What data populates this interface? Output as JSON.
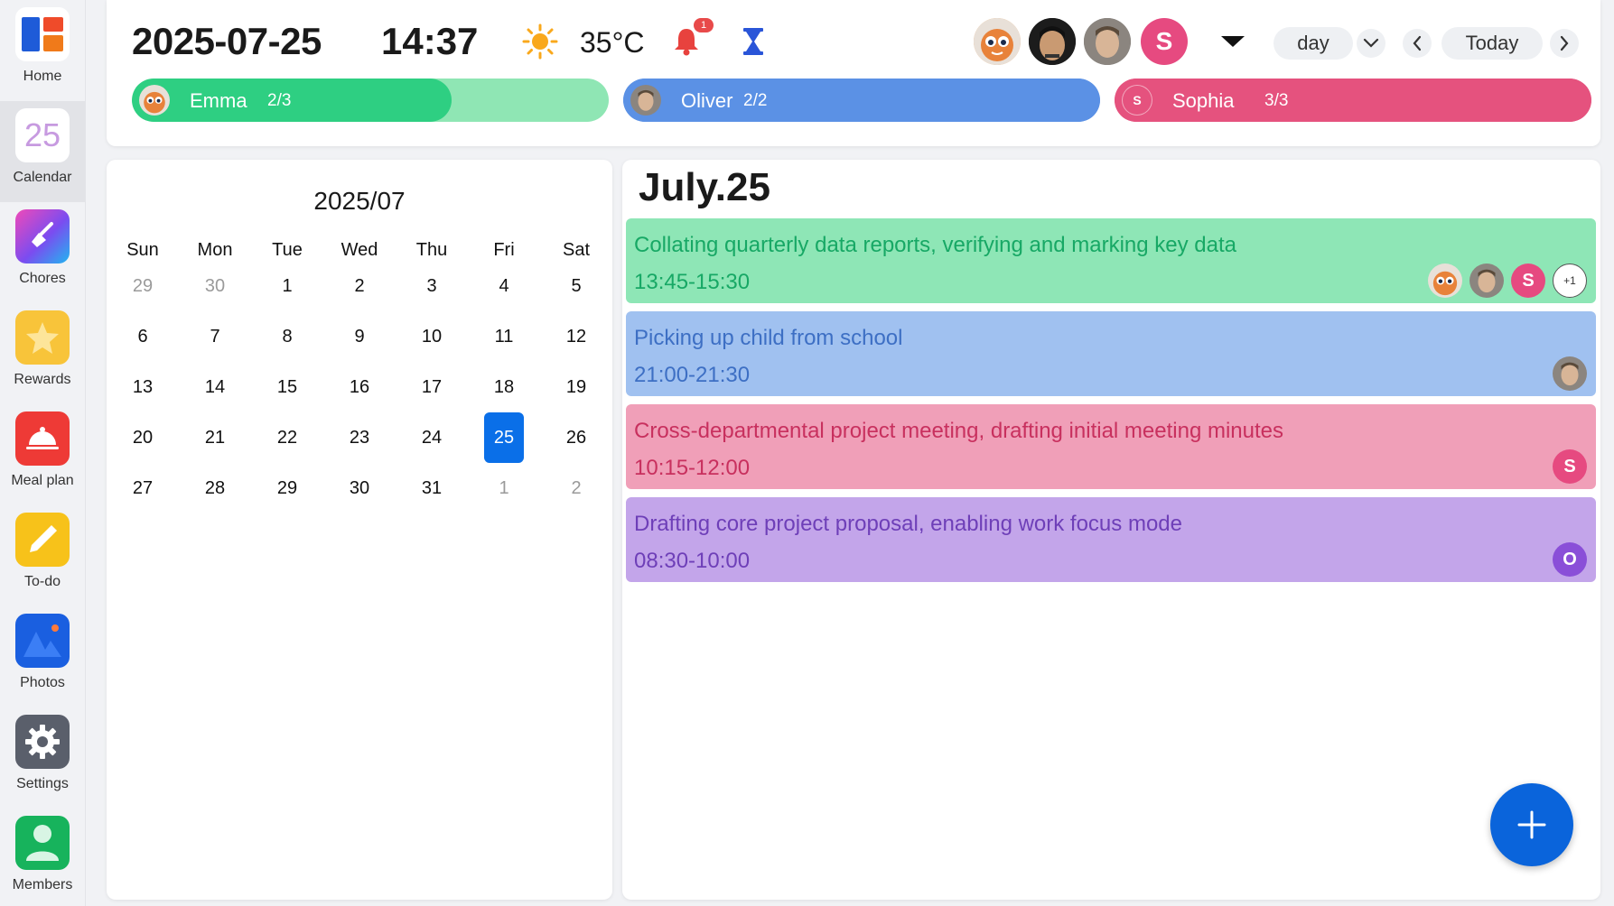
{
  "sidebar": {
    "items": [
      {
        "label": "Home",
        "icon": "home-grid-icon"
      },
      {
        "label": "Calendar",
        "icon": "calendar-icon",
        "icon_text": "25",
        "active": true
      },
      {
        "label": "Chores",
        "icon": "broom-icon"
      },
      {
        "label": "Rewards",
        "icon": "star-badge-icon"
      },
      {
        "label": "Meal plan",
        "icon": "food-cloche-icon"
      },
      {
        "label": "To-do",
        "icon": "pencil-icon"
      },
      {
        "label": "Photos",
        "icon": "mountain-photo-icon"
      },
      {
        "label": "Settings",
        "icon": "gear-icon"
      },
      {
        "label": "Members",
        "icon": "person-icon"
      }
    ]
  },
  "header": {
    "date": "2025-07-25",
    "time": "14:37",
    "weather_icon": "sun-icon",
    "temperature": "35°C",
    "notification_count": "1",
    "avatar_letter": "S",
    "view_mode": "day",
    "today_label": "Today"
  },
  "members": [
    {
      "name": "Emma",
      "count": "2/3",
      "progress": 0.67,
      "track_color": "#8fe6b4",
      "fill_color": "#2ecf82"
    },
    {
      "name": "Oliver",
      "count": "2/2",
      "progress": 1.0,
      "track_color": "#5b91e5",
      "fill_color": "#5b91e5"
    },
    {
      "name": "Sophia",
      "count": "3/3",
      "progress": 1.0,
      "track_color": "#e5527e",
      "fill_color": "#e5527e",
      "avatar_letter": "S"
    }
  ],
  "calendar": {
    "title": "2025/07",
    "weekdays": [
      "Sun",
      "Mon",
      "Tue",
      "Wed",
      "Thu",
      "Fri",
      "Sat"
    ],
    "weeks": [
      [
        "29",
        "30",
        "1",
        "2",
        "3",
        "4",
        "5"
      ],
      [
        "6",
        "7",
        "8",
        "9",
        "10",
        "11",
        "12"
      ],
      [
        "13",
        "14",
        "15",
        "16",
        "17",
        "18",
        "19"
      ],
      [
        "20",
        "21",
        "22",
        "23",
        "24",
        "25",
        "26"
      ],
      [
        "27",
        "28",
        "29",
        "30",
        "31",
        "1",
        "2"
      ]
    ],
    "selected_day": "25"
  },
  "events": {
    "title": "July.25",
    "items": [
      {
        "title": "Collating quarterly data reports, verifying and marking key data",
        "time": "13:45-15:30",
        "bg": "#8ee6b6",
        "fg": "#17a865",
        "extra": "+1"
      },
      {
        "title": "Picking up child from school",
        "time": "21:00-21:30",
        "bg": "#a0c1f0",
        "fg": "#3d6fc4"
      },
      {
        "title": "Cross-departmental project meeting, drafting initial meeting minutes",
        "time": "10:15-12:00",
        "bg": "#f09fb8",
        "fg": "#c8305e",
        "avatar_letter": "S"
      },
      {
        "title": "Drafting core project proposal, enabling work focus mode",
        "time": "08:30-10:00",
        "bg": "#c3a5ea",
        "fg": "#6e3fb8",
        "avatar_letter": "O"
      }
    ]
  },
  "fab_icon": "plus-icon"
}
